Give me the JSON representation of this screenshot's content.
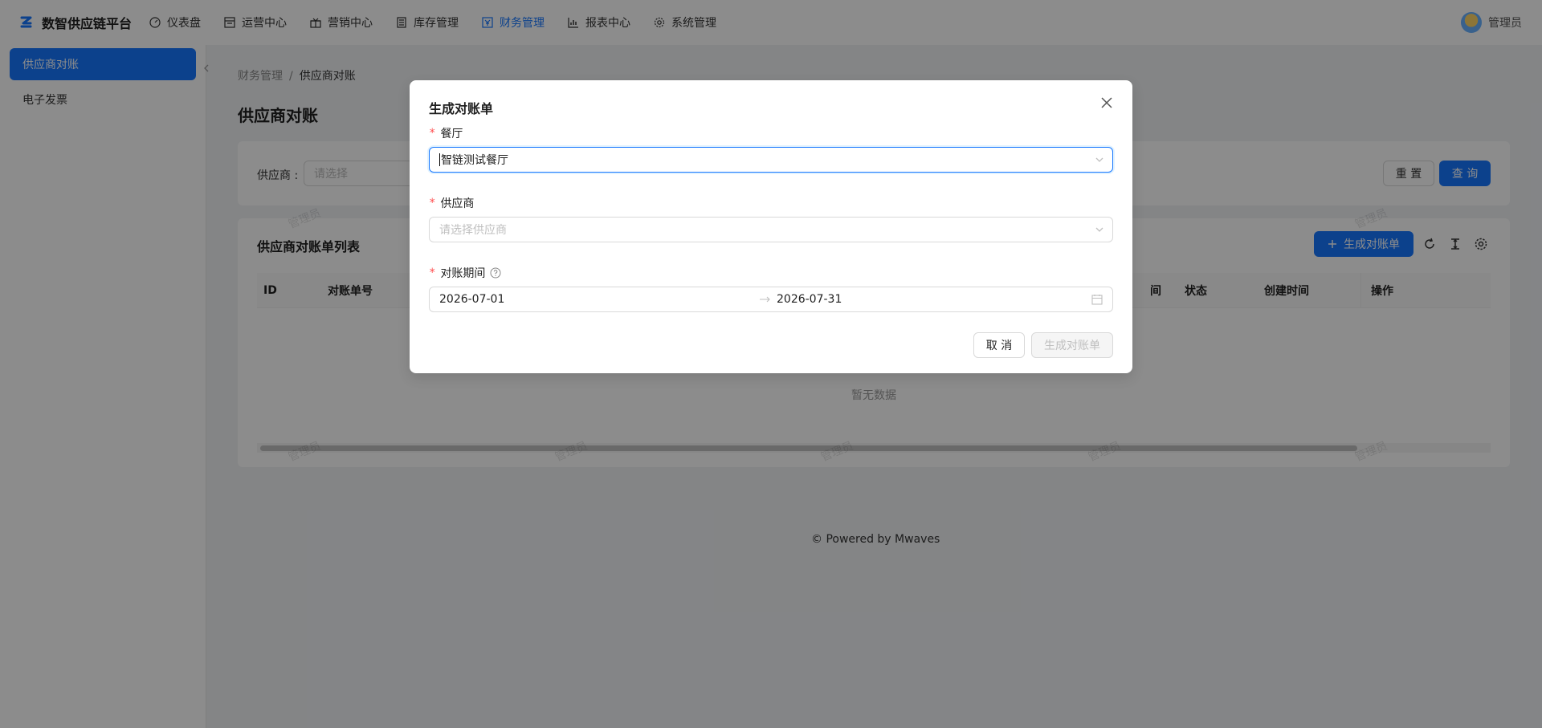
{
  "app": {
    "title": "数智供应链平台"
  },
  "nav": [
    {
      "label": "仪表盘",
      "icon": "dashboard-icon",
      "active": false
    },
    {
      "label": "运营中心",
      "icon": "operations-icon",
      "active": false
    },
    {
      "label": "营销中心",
      "icon": "marketing-icon",
      "active": false
    },
    {
      "label": "库存管理",
      "icon": "inventory-icon",
      "active": false
    },
    {
      "label": "财务管理",
      "icon": "finance-icon",
      "active": true
    },
    {
      "label": "报表中心",
      "icon": "chart-icon",
      "active": false
    },
    {
      "label": "系统管理",
      "icon": "gear-icon",
      "active": false
    }
  ],
  "user": {
    "name": "管理员"
  },
  "sidebar": {
    "items": [
      {
        "label": "供应商对账",
        "active": true
      },
      {
        "label": "电子发票",
        "active": false
      }
    ]
  },
  "breadcrumb": {
    "parent": "财务管理",
    "separator": "/",
    "current": "供应商对账"
  },
  "page": {
    "title": "供应商对账"
  },
  "filter": {
    "supplier_label": "供应商 :",
    "supplier_placeholder": "请选择",
    "reset_label": "重 置",
    "query_label": "查 询"
  },
  "list": {
    "title": "供应商对账单列表",
    "create_label": "生成对账单",
    "columns": [
      "ID",
      "对账单号",
      "",
      "状态",
      "创建时间",
      "操作"
    ],
    "partial_column_tail": "间",
    "empty_text": "暂无数据"
  },
  "footer": {
    "text": "Powered by Mwaves"
  },
  "watermark": "管理员",
  "modal": {
    "title": "生成对账单",
    "restaurant": {
      "label": "餐厅",
      "value": "智链测试餐厅"
    },
    "supplier": {
      "label": "供应商",
      "placeholder": "请选择供应商"
    },
    "period": {
      "label": "对账期间",
      "start": "2026-07-01",
      "end": "2026-07-31"
    },
    "cancel_label": "取 消",
    "submit_label": "生成对账单"
  },
  "colors": {
    "primary": "#1677ff",
    "required": "#ff4d4f"
  }
}
